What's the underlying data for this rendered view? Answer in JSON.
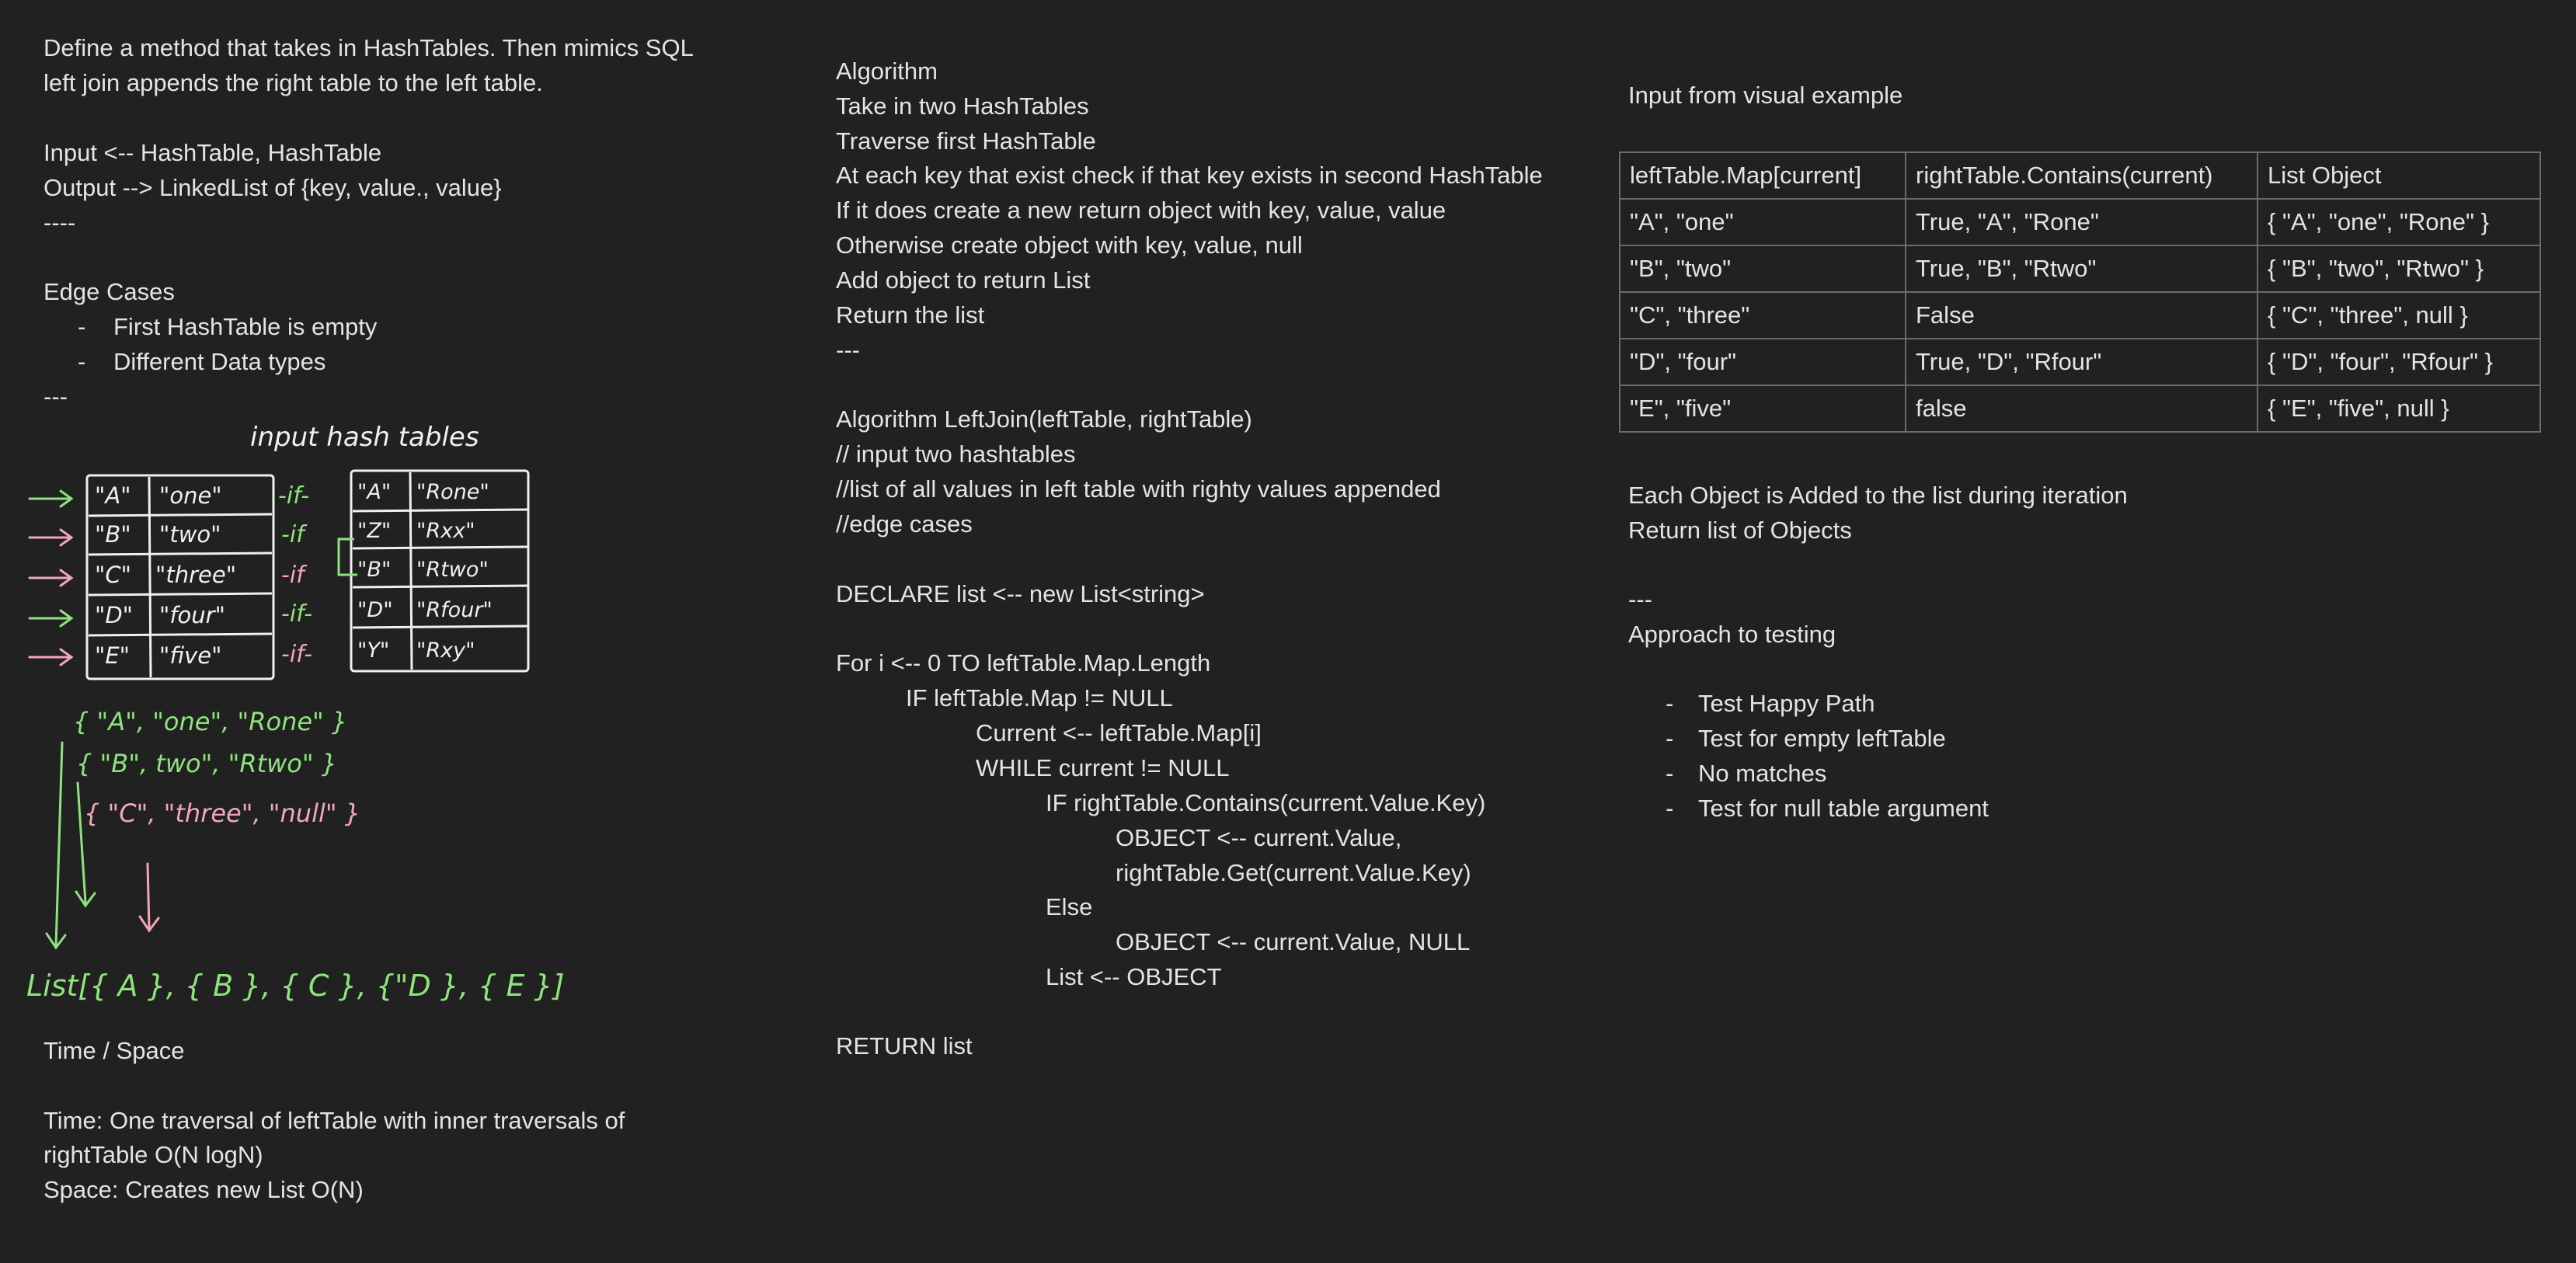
{
  "left": {
    "lines": [
      "Define a method that takes in HashTables.  Then mimics SQL",
      "left join appends the right table to the left table.",
      "",
      "Input <-- HashTable, HashTable",
      "Output --> LinkedList of {key, value., value}",
      "----",
      "",
      "Edge Cases",
      "First HashTable is empty",
      "Different Data types",
      "---"
    ],
    "time_space": [
      "Time / Space",
      "",
      "Time: One traversal of leftTable with inner traversals of",
      "rightTable  O(N logN)",
      "Space: Creates new List O(N)"
    ]
  },
  "sketch": {
    "title": "input hash tables",
    "left_table": [
      [
        "\"A\"",
        "\"one\""
      ],
      [
        "\"B\"",
        "\"two\""
      ],
      [
        "\"C\"",
        "\"three\""
      ],
      [
        "\"D\"",
        "\"four\""
      ],
      [
        "\"E\"",
        "\"five\""
      ]
    ],
    "right_table": [
      [
        "\"A\"",
        "\"Rone\""
      ],
      [
        "\"Z\"",
        "\"Rxx\""
      ],
      [
        "\"B\"",
        "\"Rtwo\""
      ],
      [
        "\"D\"",
        "\"Rfour\""
      ],
      [
        "\"Y\"",
        "\"Rxy\""
      ]
    ],
    "if_labels": [
      "-if-",
      "-if",
      "-if",
      "-if-",
      "-if-"
    ],
    "objects": [
      "{ \"A\", \"one\", \"Rone\" }",
      "{ \"B\", two\", \"Rtwo\" }",
      "{ \"C\", \"three\", \"null\" }"
    ],
    "list": "List[{ A }, { B }, { C }, {\"D }, { E }]",
    "colors": {
      "green": "#8fe37f",
      "pink": "#f2a7b8",
      "white": "#f0f0f0"
    }
  },
  "middle": {
    "lines": [
      "Algorithm",
      "Take in two HashTables",
      "Traverse first HashTable",
      "At each key that exist check if that key exists in second HashTable",
      "If it does create a new return object with key, value, value",
      "Otherwise create object with key, value, null",
      "Add object to return List",
      "Return the list",
      "---",
      "",
      "Algorithm LeftJoin(leftTable, rightTable)",
      "// input two hashtables",
      "//list of all values in left table with righty values appended",
      "//edge cases",
      "",
      "DECLARE list <-- new List<string>",
      "",
      "For i <-- 0 TO leftTable.Map.Length",
      "IF leftTable.Map != NULL",
      "Current <-- leftTable.Map[i]",
      "WHILE current != NULL",
      "IF rightTable.Contains(current.Value.Key)",
      "OBJECT <-- current.Value,",
      "rightTable.Get(current.Value.Key)",
      "Else",
      "OBJECT <-- current.Value, NULL",
      "List <-- OBJECT",
      "",
      "RETURN list"
    ]
  },
  "right": {
    "heading": "Input from visual example",
    "table_headers": [
      "leftTable.Map[current]",
      "rightTable.Contains(current)",
      "List Object"
    ],
    "table_rows": [
      [
        "\"A\", \"one\"",
        "True, \"A\", \"Rone\"",
        "{ \"A\", \"one\", \"Rone\" }"
      ],
      [
        "\"B\", \"two\"",
        "True, \"B\", \"Rtwo\"",
        "{ \"B\", \"two\", \"Rtwo\" }"
      ],
      [
        "\"C\", \"three\"",
        "False",
        "{ \"C\", \"three\", null }"
      ],
      [
        "\"D\", \"four\"",
        "True, \"D\", \"Rfour\"",
        "{ \"D\", \"four\", \"Rfour\" }"
      ],
      [
        "\"E\", \"five\"",
        "false",
        "{ \"E\", \"five\", null }"
      ]
    ],
    "after_lines": [
      "Each Object is Added to the list during iteration",
      "Return list of Objects",
      "",
      "---",
      "Approach to testing"
    ],
    "tests": [
      "Test Happy Path",
      "Test for empty leftTable",
      "No matches",
      "Test for null table argument"
    ]
  }
}
